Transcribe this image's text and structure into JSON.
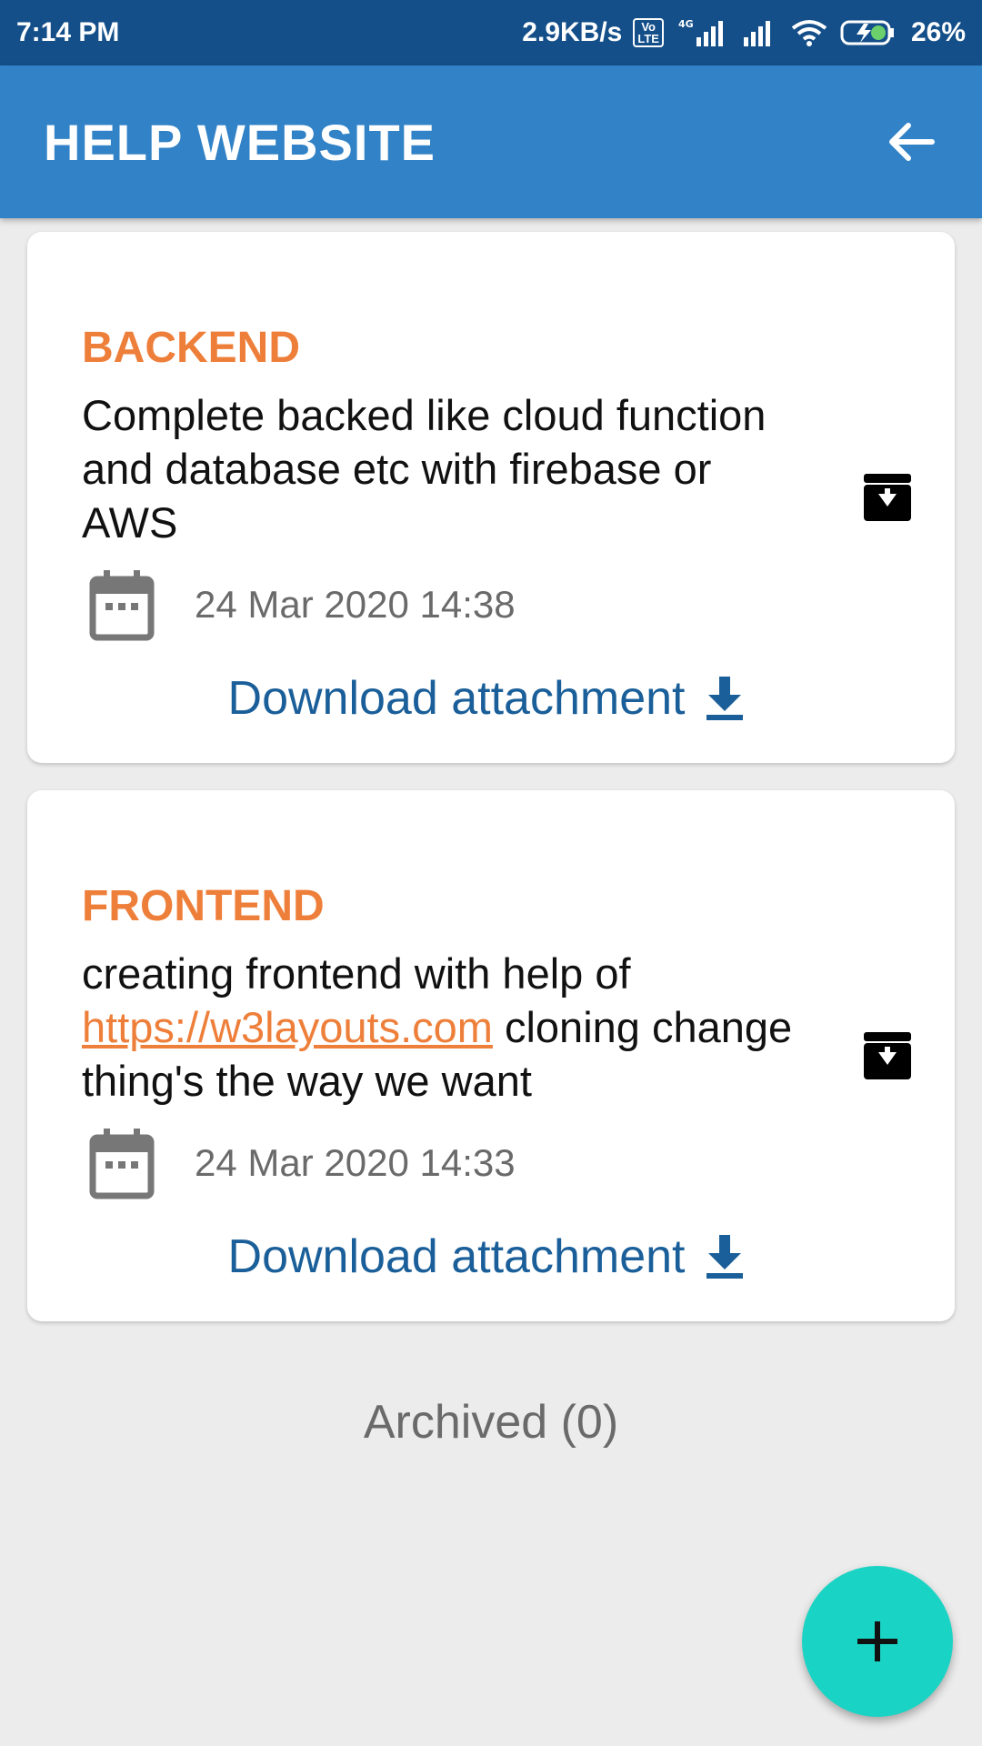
{
  "status_bar": {
    "time": "7:14 PM",
    "net_speed": "2.9KB/s",
    "volte_top": "Vo",
    "volte_bottom": "LTE",
    "network_type": "4G",
    "battery": "26%"
  },
  "app_bar": {
    "title": "HELP WEBSITE",
    "back_icon": "arrow-back-icon"
  },
  "cards": [
    {
      "title": "BACKEND",
      "description": "Complete backed like cloud function and database etc with firebase or AWS",
      "date": "24 Mar 2020 14:38",
      "download_label": "Download attachment",
      "archive_icon": "archive-icon"
    },
    {
      "title": "FRONTEND",
      "description_before": "creating frontend with help of ",
      "description_link": "https://w3layouts.com",
      "description_after": " cloning change thing's the way we want",
      "date": "24 Mar 2020 14:33",
      "download_label": "Download attachment",
      "archive_icon": "archive-icon"
    }
  ],
  "archived_label": "Archived (0)",
  "fab": {
    "icon": "plus-icon"
  },
  "colors": {
    "status_bar": "#144f8a",
    "app_bar": "#3182c6",
    "card_title": "#ee7f3a",
    "download": "#1a5f99",
    "fab": "#19d4c4",
    "background": "#ececec"
  }
}
